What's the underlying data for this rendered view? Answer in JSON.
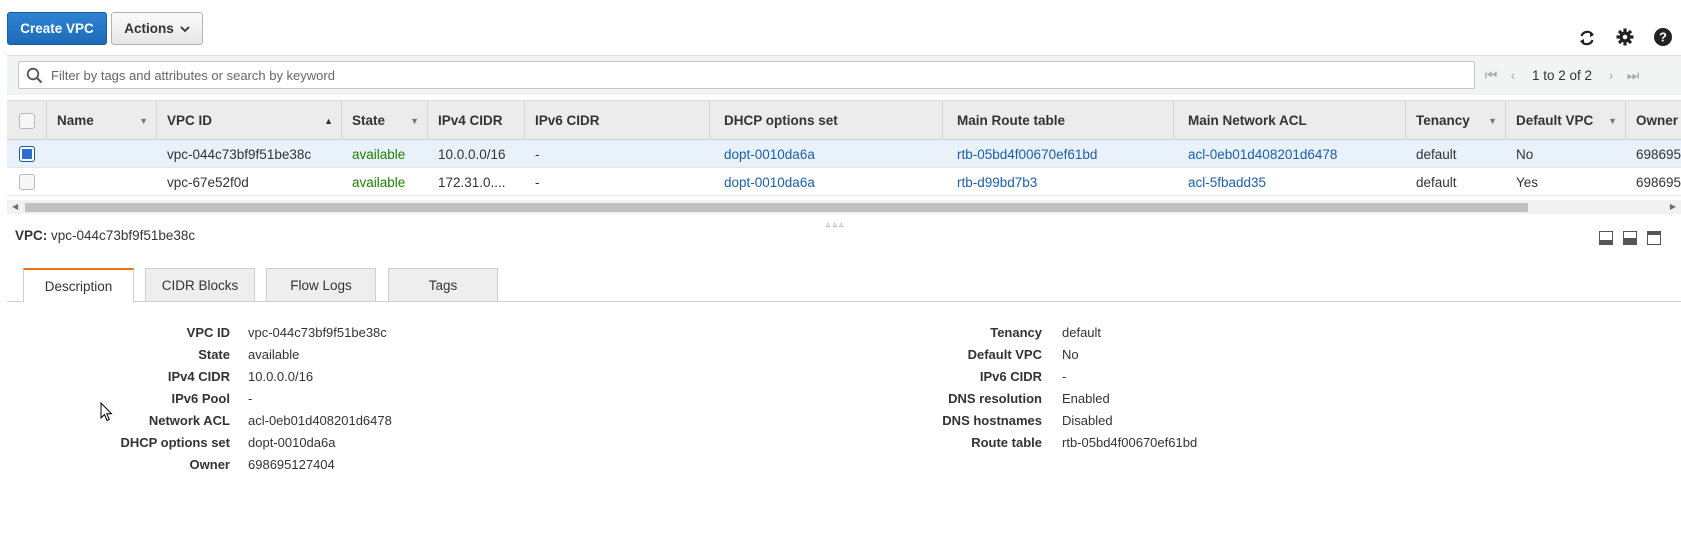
{
  "toolbar": {
    "create_label": "Create VPC",
    "actions_label": "Actions",
    "refresh_icon": "refresh-icon",
    "settings_icon": "gear-icon",
    "help_icon": "help-icon"
  },
  "filter": {
    "placeholder": "Filter by tags and attributes or search by keyword",
    "pager_text": "1 to 2 of 2"
  },
  "table": {
    "headers": {
      "name": "Name",
      "vpc_id": "VPC ID",
      "state": "State",
      "ipv4": "IPv4 CIDR",
      "ipv6": "IPv6 CIDR",
      "dhcp": "DHCP options set",
      "route": "Main Route table",
      "acl": "Main Network ACL",
      "tenancy": "Tenancy",
      "default_vpc": "Default VPC",
      "owner": "Owner"
    },
    "rows": [
      {
        "name": "",
        "vpc_id": "vpc-044c73bf9f51be38c",
        "state": "available",
        "ipv4": "10.0.0.0/16",
        "ipv6": "-",
        "dhcp": "dopt-0010da6a",
        "route": "rtb-05bd4f00670ef61bd",
        "acl": "acl-0eb01d408201d6478",
        "tenancy": "default",
        "default_vpc": "No",
        "owner": "698695"
      },
      {
        "name": "",
        "vpc_id": "vpc-67e52f0d",
        "state": "available",
        "ipv4": "172.31.0....",
        "ipv6": "-",
        "dhcp": "dopt-0010da6a",
        "route": "rtb-d99bd7b3",
        "acl": "acl-5fbadd35",
        "tenancy": "default",
        "default_vpc": "Yes",
        "owner": "698695"
      }
    ]
  },
  "details": {
    "title_label": "VPC:",
    "title_value": "vpc-044c73bf9f51be38c",
    "tabs": [
      "Description",
      "CIDR Blocks",
      "Flow Logs",
      "Tags"
    ],
    "left": [
      {
        "label": "VPC ID",
        "value": "vpc-044c73bf9f51be38c"
      },
      {
        "label": "State",
        "value": "available"
      },
      {
        "label": "IPv4 CIDR",
        "value": "10.0.0.0/16"
      },
      {
        "label": "IPv6 Pool",
        "value": "-"
      },
      {
        "label": "Network ACL",
        "value": "acl-0eb01d408201d6478"
      },
      {
        "label": "DHCP options set",
        "value": "dopt-0010da6a"
      },
      {
        "label": "Owner",
        "value": "698695127404"
      }
    ],
    "right": [
      {
        "label": "Tenancy",
        "value": "default"
      },
      {
        "label": "Default VPC",
        "value": "No"
      },
      {
        "label": "IPv6 CIDR",
        "value": "-"
      },
      {
        "label": "DNS resolution",
        "value": "Enabled"
      },
      {
        "label": "DNS hostnames",
        "value": "Disabled"
      },
      {
        "label": "Route table",
        "value": "rtb-05bd4f00670ef61bd"
      }
    ]
  },
  "colors": {
    "primary": "#1c6bb8",
    "link": "#1c5fa8",
    "available": "#1d8102",
    "active_tab": "#ec7211"
  }
}
